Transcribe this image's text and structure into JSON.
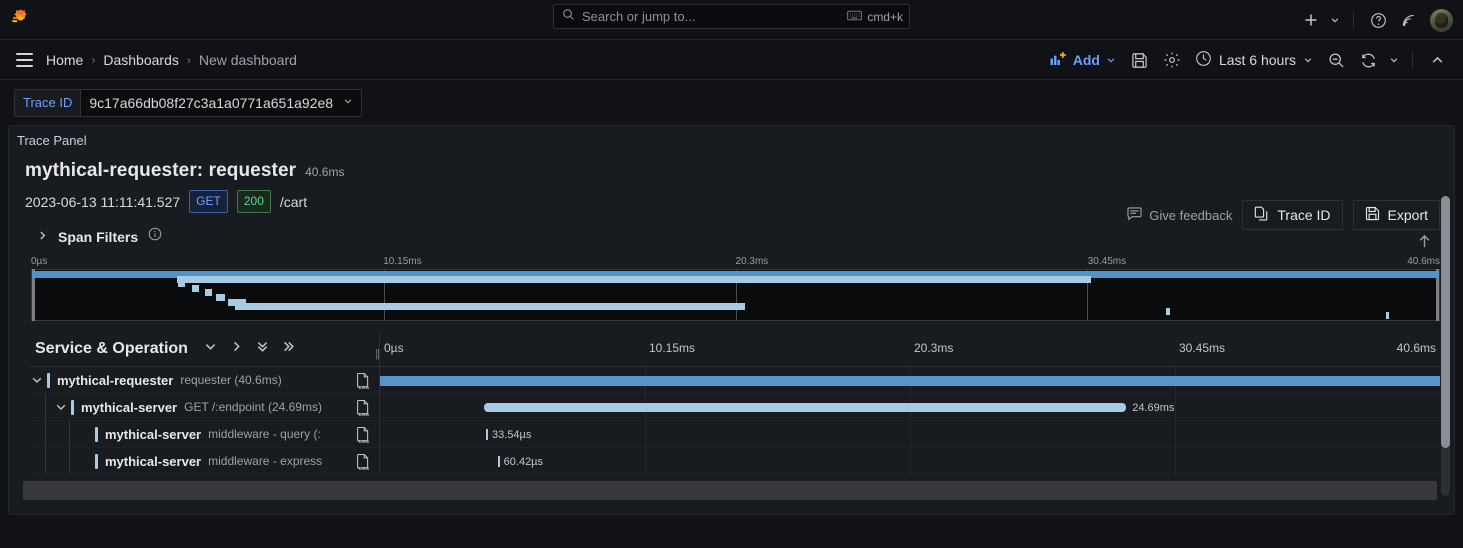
{
  "topbar": {
    "logo_icon": "grafana-logo-icon",
    "search": {
      "placeholder": "Search or jump to...",
      "shortcut": "cmd+k",
      "icon": "search-icon",
      "kbd_icon": "keyboard-icon"
    },
    "actions": [
      {
        "name": "create-new-button",
        "icon": "plus-icon",
        "label": ""
      },
      {
        "name": "create-new-caret",
        "icon": "chevron-down-icon",
        "label": ""
      },
      {
        "name": "help-button",
        "icon": "question-circle-icon",
        "label": ""
      },
      {
        "name": "news-button",
        "icon": "rss-icon",
        "label": ""
      }
    ],
    "avatar_alt": "user-avatar"
  },
  "navbar": {
    "menu_icon": "hamburger-menu-icon",
    "breadcrumbs": [
      {
        "label": "Home",
        "current": false
      },
      {
        "label": "Dashboards",
        "current": false
      },
      {
        "label": "New dashboard",
        "current": true
      }
    ],
    "separator": "›",
    "add_label": "Add",
    "add_icon": "bar-chart-plus-icon",
    "add_caret": "chevron-down-icon",
    "save_icon": "save-icon",
    "settings_icon": "gear-icon",
    "time_range": "Last 6 hours",
    "time_icon": "clock-icon",
    "time_caret": "chevron-down-icon",
    "zoom_out_icon": "zoom-out-icon",
    "refresh_icon": "refresh-icon",
    "refresh_caret": "chevron-down-icon",
    "collapse_icon": "chevron-up-icon"
  },
  "variables": {
    "trace_id": {
      "label": "Trace ID",
      "value": "9c17a66db08f27c3a1a0771a651a92e8",
      "caret": "chevron-down-icon"
    }
  },
  "panel": {
    "title": "Trace Panel"
  },
  "trace": {
    "title": "mythical-requester: requester",
    "duration": "40.6ms",
    "timestamp": "2023-06-13 11:11:41.527",
    "method": "GET",
    "status": "200",
    "url": "/cart",
    "feedback_label": "Give feedback",
    "feedback_icon": "comment-icon",
    "trace_id_button": "Trace ID",
    "trace_id_icon": "copy-icon",
    "export_button": "Export",
    "export_icon": "save-icon"
  },
  "span_filters": {
    "label": "Span Filters",
    "caret": "chevron-right-icon",
    "info_icon": "info-circle-icon"
  },
  "minimap": {
    "ticks": [
      "0µs",
      "10.15ms",
      "20.3ms",
      "30.45ms",
      "40.6ms"
    ],
    "bars": [
      {
        "left_pct": 0.0,
        "width_pct": 100.0,
        "row": 0,
        "root": true
      },
      {
        "left_pct": 10.3,
        "width_pct": 65.0,
        "row": 1,
        "root": false
      },
      {
        "left_pct": 10.4,
        "width_pct": 0.5,
        "row": 2,
        "root": false
      },
      {
        "left_pct": 11.4,
        "width_pct": 0.5,
        "row": 3,
        "root": false
      },
      {
        "left_pct": 12.3,
        "width_pct": 0.5,
        "row": 4,
        "root": false
      },
      {
        "left_pct": 13.1,
        "width_pct": 0.6,
        "row": 5,
        "root": false
      },
      {
        "left_pct": 13.9,
        "width_pct": 1.3,
        "row": 6,
        "root": false
      },
      {
        "left_pct": 14.4,
        "width_pct": 36.3,
        "row": 7,
        "root": false
      },
      {
        "left_pct": 80.6,
        "width_pct": 0.25,
        "row": 8,
        "root": false
      },
      {
        "left_pct": 96.2,
        "width_pct": 0.25,
        "row": 9,
        "root": false
      }
    ]
  },
  "timeline": {
    "column_header": "Service & Operation",
    "controls": [
      {
        "name": "collapse-one-level-button",
        "icon": "chevron-down-icon"
      },
      {
        "name": "expand-one-level-button",
        "icon": "chevron-right-icon"
      },
      {
        "name": "collapse-all-button",
        "icon": "double-chevron-down-icon"
      },
      {
        "name": "expand-all-button",
        "icon": "double-chevron-right-icon"
      }
    ],
    "resize_handle": "column-resize-handle",
    "ticks": [
      "0µs",
      "10.15ms",
      "20.3ms",
      "30.45ms",
      "40.6ms"
    ],
    "scroll_top_icon": "arrow-up-icon"
  },
  "spans": [
    {
      "service": "mythical-requester",
      "operation": "requester (40.6ms)",
      "depth": 0,
      "caret": "chevron-down-icon",
      "has_logs": true,
      "bar": {
        "left_pct": 0.0,
        "width_pct": 100.0,
        "root": true
      },
      "bar_label": ""
    },
    {
      "service": "mythical-server",
      "operation": "GET /:endpoint (24.69ms)",
      "depth": 1,
      "caret": "chevron-down-icon",
      "has_logs": true,
      "bar": {
        "left_pct": 9.8,
        "width_pct": 60.6,
        "root": false
      },
      "bar_label": "24.69ms"
    },
    {
      "service": "mythical-server",
      "operation": "middleware - query (:",
      "depth": 2,
      "caret": "",
      "has_logs": true,
      "bar": {
        "left_pct": 10.0,
        "width_pct": 0.2,
        "root": false
      },
      "bar_label": "33.54µs"
    },
    {
      "service": "mythical-server",
      "operation": "middleware - express",
      "depth": 2,
      "caret": "",
      "has_logs": true,
      "bar": {
        "left_pct": 11.1,
        "width_pct": 0.2,
        "root": false
      },
      "bar_label": "60.42µs"
    }
  ]
}
